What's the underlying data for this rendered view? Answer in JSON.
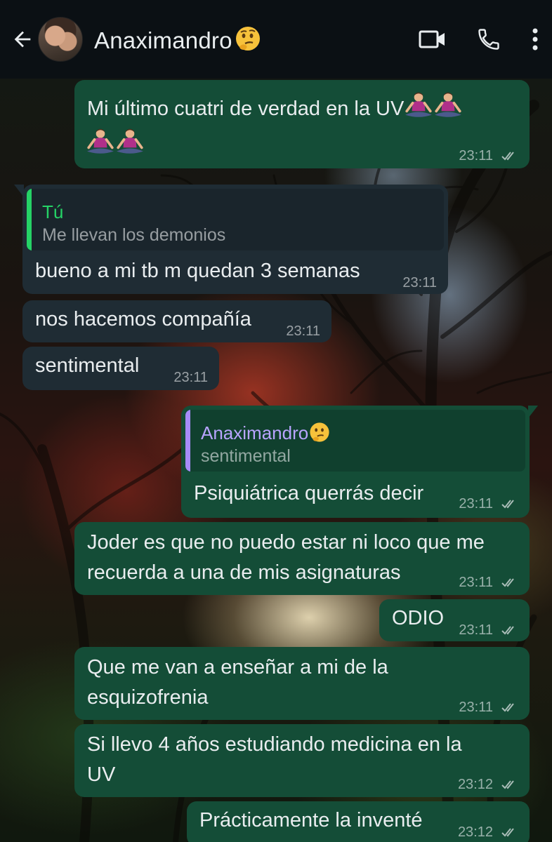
{
  "header": {
    "contact_name": "Anaximandro",
    "contact_emoji": "thinking-face",
    "icons": [
      "back-arrow-icon",
      "video-call-icon",
      "voice-call-icon",
      "more-vert-icon"
    ]
  },
  "colors": {
    "header_bg": "#0b1014",
    "outgoing_bubble": "#144d37",
    "incoming_bubble": "#1f2c34",
    "reply_bar_self": "#25d366",
    "reply_bar_contact": "#a78bfa",
    "text": "#e9edef"
  },
  "messages": [
    {
      "id": "m1",
      "direction": "out",
      "text_line1": "Mi último cuatri de verdad en la UV",
      "emojis": "person-in-lotus-position x4",
      "time": "23:11",
      "status": "read"
    },
    {
      "id": "m2",
      "direction": "in",
      "reply": {
        "author": "Tú",
        "text": "Me llevan los demonios"
      },
      "text": "bueno a mi tb m quedan 3 semanas",
      "time": "23:11"
    },
    {
      "id": "m3",
      "direction": "in",
      "text": "nos hacemos compañía",
      "time": "23:11"
    },
    {
      "id": "m4",
      "direction": "in",
      "text": "sentimental",
      "time": "23:11"
    },
    {
      "id": "m5",
      "direction": "out",
      "reply": {
        "author": "Anaximandro",
        "text": "sentimental"
      },
      "text": "Psiquiátrica querrás decir",
      "time": "23:11",
      "status": "read"
    },
    {
      "id": "m6",
      "direction": "out",
      "lines": [
        "Joder es que no puedo estar ni loco que me",
        "recuerda a una de mis asignaturas"
      ],
      "time": "23:11",
      "status": "read"
    },
    {
      "id": "m7",
      "direction": "out",
      "text": "ODIO",
      "time": "23:11",
      "status": "read"
    },
    {
      "id": "m8",
      "direction": "out",
      "lines": [
        "Que me van a enseñar a mi de la",
        "esquizofrenia"
      ],
      "time": "23:11",
      "status": "read"
    },
    {
      "id": "m9",
      "direction": "out",
      "lines": [
        "Si llevo 4 años estudiando medicina en la",
        "UV"
      ],
      "time": "23:12",
      "status": "read"
    },
    {
      "id": "m10",
      "direction": "out",
      "text": "Prácticamente la inventé",
      "time": "23:12",
      "status": "read"
    }
  ]
}
